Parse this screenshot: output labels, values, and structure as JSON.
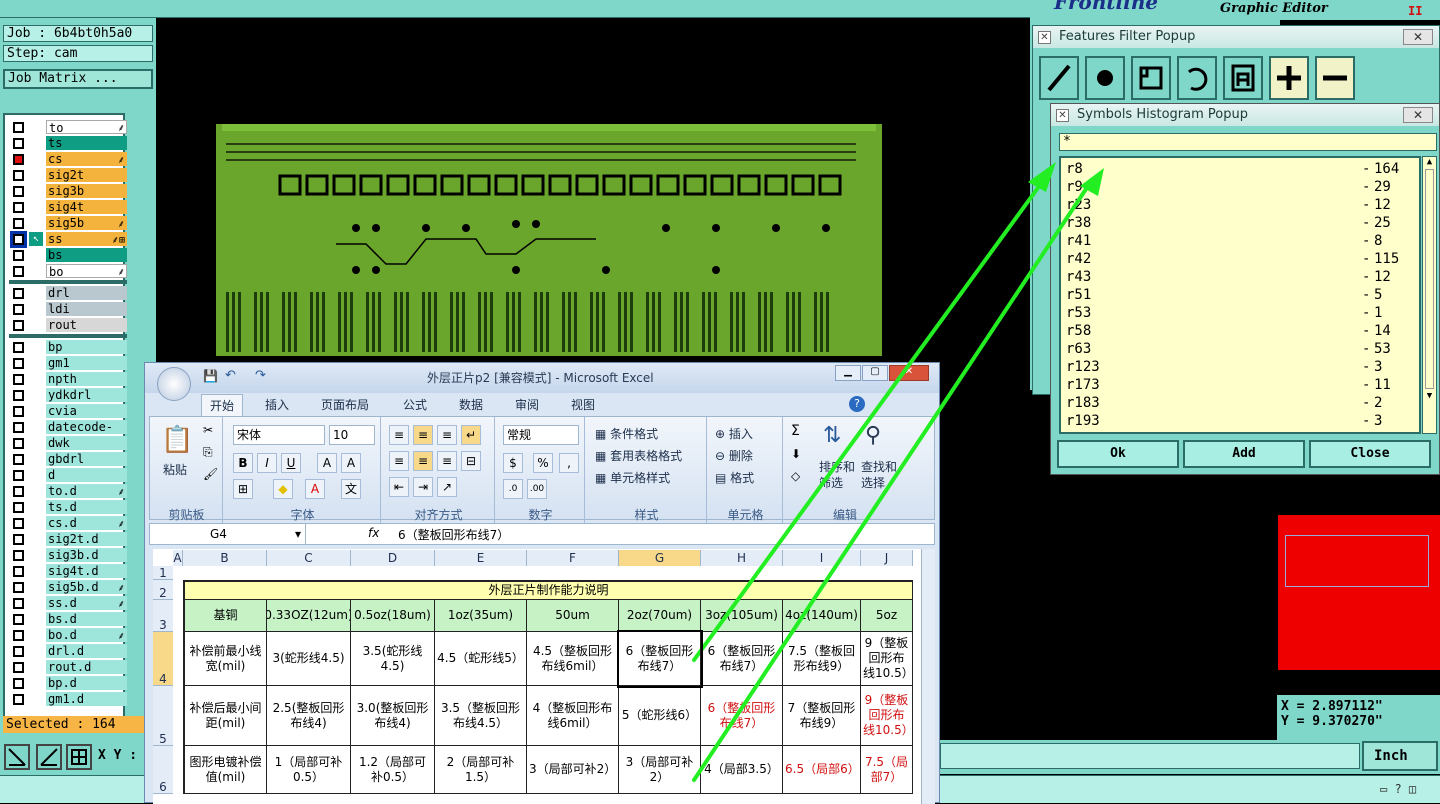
{
  "job": {
    "job_label": "Job : 6b4bt0h5a0",
    "step_label": "Step: cam",
    "matrix_button": "Job Matrix ..."
  },
  "layers": {
    "group1": [
      {
        "name": "to",
        "color": "white",
        "mark": "⸙"
      },
      {
        "name": "ts",
        "color": "teal",
        "mark": ""
      },
      {
        "name": "cs",
        "color": "orange",
        "mark": "⸙",
        "checked_red": true
      },
      {
        "name": "sig2t",
        "color": "orange",
        "mark": ""
      },
      {
        "name": "sig3b",
        "color": "orange",
        "mark": ""
      },
      {
        "name": "sig4t",
        "color": "orange",
        "mark": ""
      },
      {
        "name": "sig5b",
        "color": "orange",
        "mark": "⸙"
      },
      {
        "name": "ss",
        "color": "orange",
        "mark": "⸙⊞",
        "selected": true
      },
      {
        "name": "bs",
        "color": "teal",
        "mark": ""
      },
      {
        "name": "bo",
        "color": "white",
        "mark": "⸙"
      }
    ],
    "group2": [
      {
        "name": "drl",
        "color": "gray"
      },
      {
        "name": "ldi",
        "color": "gray"
      },
      {
        "name": "rout",
        "color": "lgray"
      }
    ],
    "group3": [
      {
        "name": "bp",
        "color": "cyan",
        "mark": ""
      },
      {
        "name": "gm1",
        "color": "cyan",
        "mark": ""
      },
      {
        "name": "npth",
        "color": "cyan",
        "mark": ""
      },
      {
        "name": "ydkdrl",
        "color": "cyan",
        "mark": ""
      },
      {
        "name": "cvia",
        "color": "cyan",
        "mark": ""
      },
      {
        "name": "datecode-pt",
        "color": "cyan",
        "mark": ""
      },
      {
        "name": "dwk",
        "color": "cyan",
        "mark": ""
      },
      {
        "name": "gbdrl",
        "color": "cyan",
        "mark": ""
      },
      {
        "name": "d",
        "color": "cyan",
        "mark": ""
      },
      {
        "name": "to.d",
        "color": "cyan",
        "mark": "⸙"
      },
      {
        "name": "ts.d",
        "color": "cyan",
        "mark": ""
      },
      {
        "name": "cs.d",
        "color": "cyan",
        "mark": "⸙"
      },
      {
        "name": "sig2t.d",
        "color": "cyan",
        "mark": ""
      },
      {
        "name": "sig3b.d",
        "color": "cyan",
        "mark": ""
      },
      {
        "name": "sig4t.d",
        "color": "cyan",
        "mark": ""
      },
      {
        "name": "sig5b.d",
        "color": "cyan",
        "mark": "⸙"
      },
      {
        "name": "ss.d",
        "color": "cyan",
        "mark": "⸙"
      },
      {
        "name": "bs.d",
        "color": "cyan",
        "mark": ""
      },
      {
        "name": "bo.d",
        "color": "cyan",
        "mark": "⸙"
      },
      {
        "name": "drl.d",
        "color": "cyan",
        "mark": ""
      },
      {
        "name": "rout.d",
        "color": "cyan",
        "mark": ""
      },
      {
        "name": "bp.d",
        "color": "cyan",
        "mark": ""
      },
      {
        "name": "gm1.d",
        "color": "cyan",
        "mark": ""
      }
    ]
  },
  "status": {
    "selected": "Selected : 164",
    "xy_label": "X Y :",
    "unit": "Inch",
    "coord_x": "X = 2.897112\"",
    "coord_y": "Y = 9.370270\""
  },
  "app": {
    "title": "Graphic Editor",
    "logo": "Frontline"
  },
  "features_popup": {
    "title": "Features Filter Popup"
  },
  "histogram_popup": {
    "title": "Symbols Histogram Popup",
    "filter_value": "*",
    "rows": [
      {
        "sym": "r8",
        "count": "164"
      },
      {
        "sym": "r9",
        "count": "29"
      },
      {
        "sym": "r23",
        "count": "12"
      },
      {
        "sym": "r38",
        "count": "25"
      },
      {
        "sym": "r41",
        "count": "8"
      },
      {
        "sym": "r42",
        "count": "115"
      },
      {
        "sym": "r43",
        "count": "12"
      },
      {
        "sym": "r51",
        "count": "5"
      },
      {
        "sym": "r53",
        "count": "1"
      },
      {
        "sym": "r58",
        "count": "14"
      },
      {
        "sym": "r63",
        "count": "53"
      },
      {
        "sym": "r123",
        "count": "3"
      },
      {
        "sym": "r173",
        "count": "11"
      },
      {
        "sym": "r183",
        "count": "2"
      },
      {
        "sym": "r193",
        "count": "3"
      }
    ],
    "ok": "Ok",
    "add": "Add",
    "close": "Close"
  },
  "excel": {
    "title": "外层正片p2 [兼容模式] - Microsoft Excel",
    "tabs": [
      "开始",
      "插入",
      "页面布局",
      "公式",
      "数据",
      "审阅",
      "视图"
    ],
    "clipboard": {
      "paste": "粘贴",
      "label": "剪贴板"
    },
    "font": {
      "name": "宋体",
      "size": "10",
      "label": "字体"
    },
    "align": {
      "label": "对齐方式"
    },
    "number": {
      "format": "常规",
      "label": "数字"
    },
    "styles": {
      "cond": "条件格式",
      "table": "套用表格格式",
      "cell": "单元格样式",
      "label": "样式"
    },
    "cells": {
      "insert": "插入",
      "delete": "删除",
      "format": "格式",
      "label": "单元格"
    },
    "edit": {
      "sort": "排序和\n筛选",
      "find": "查找和\n选择",
      "label": "编辑"
    },
    "namebox": "G4",
    "formula": "6（整板回形布线7）",
    "col_headers": [
      "A",
      "B",
      "C",
      "D",
      "E",
      "F",
      "G",
      "H",
      "I",
      "J"
    ],
    "row_headers": [
      "1",
      "2",
      "3",
      "4",
      "5",
      "6"
    ],
    "sheet_title": "外层正片制作能力说明",
    "header_row": [
      "基铜",
      "0.33OZ(12um)",
      "0.5oz(18um)",
      "1oz(35um)",
      "50um",
      "2oz(70um)",
      "3oz(105um)",
      "4oz(140um)",
      "5oz"
    ],
    "row4": [
      "补偿前最小线宽(mil)",
      "3(蛇形线4.5)",
      "3.5(蛇形线4.5)",
      "4.5（蛇形线5）",
      "4.5（整板回形布线6mil）",
      "6（整板回形布线7）",
      "6（整板回形布线7）",
      "7.5（整板回形布线9）",
      "9（整板回形布线10.5）"
    ],
    "row5": [
      "补偿后最小间距(mil)",
      "2.5(整板回形布线4)",
      "3.0(整板回形布线4)",
      "3.5（整板回形布线4.5）",
      "4（整板回形布线6mil）",
      "5（蛇形线6）",
      "6（整板回形布线7）",
      "7（整板回形布线9）",
      "9（整板回形布线10.5）"
    ],
    "row6": [
      "图形电镀补偿值(mil)",
      "1（局部可补0.5）",
      "1.2（局部可补0.5）",
      "2（局部可补1.5）",
      "3（局部可补2）",
      "3（局部可补2）",
      "4（局部3.5）",
      "6.5（局部6）",
      "7.5（局部7）"
    ]
  }
}
